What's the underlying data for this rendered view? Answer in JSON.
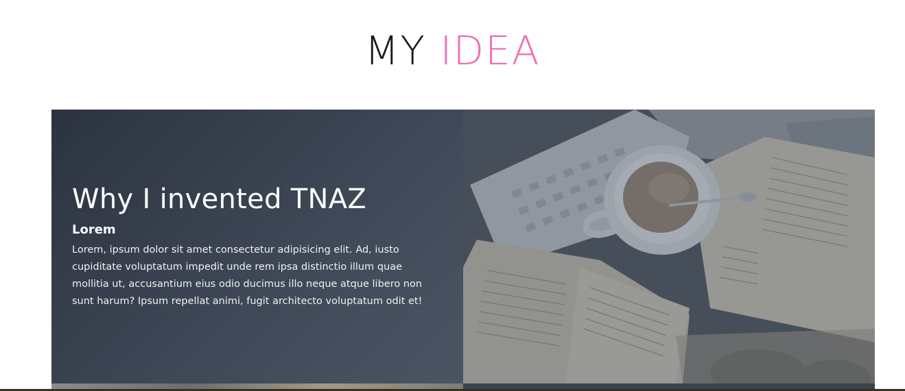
{
  "section": {
    "title_lead": "MY",
    "title_accent": "IDEA"
  },
  "card": {
    "heading": "Why I invented TNAZ",
    "subheading": "Lorem",
    "body": "Lorem, ipsum dolor sit amet consectetur adipisicing elit. Ad, iusto cupiditate voluptatum impedit unde rem ipsa distinctio illum quae mollitia ut, accusantium eius odio ducimus illo neque atque libero non sunt harum? Ipsum repellat animi, fugit architecto voluptatum odit et!"
  },
  "photo": {
    "subject": "coffee-books-keyboard-photo"
  },
  "colors": {
    "accent": "#ee6fb4",
    "card_bg": "#3e4756",
    "overlay": "#4a5563"
  }
}
